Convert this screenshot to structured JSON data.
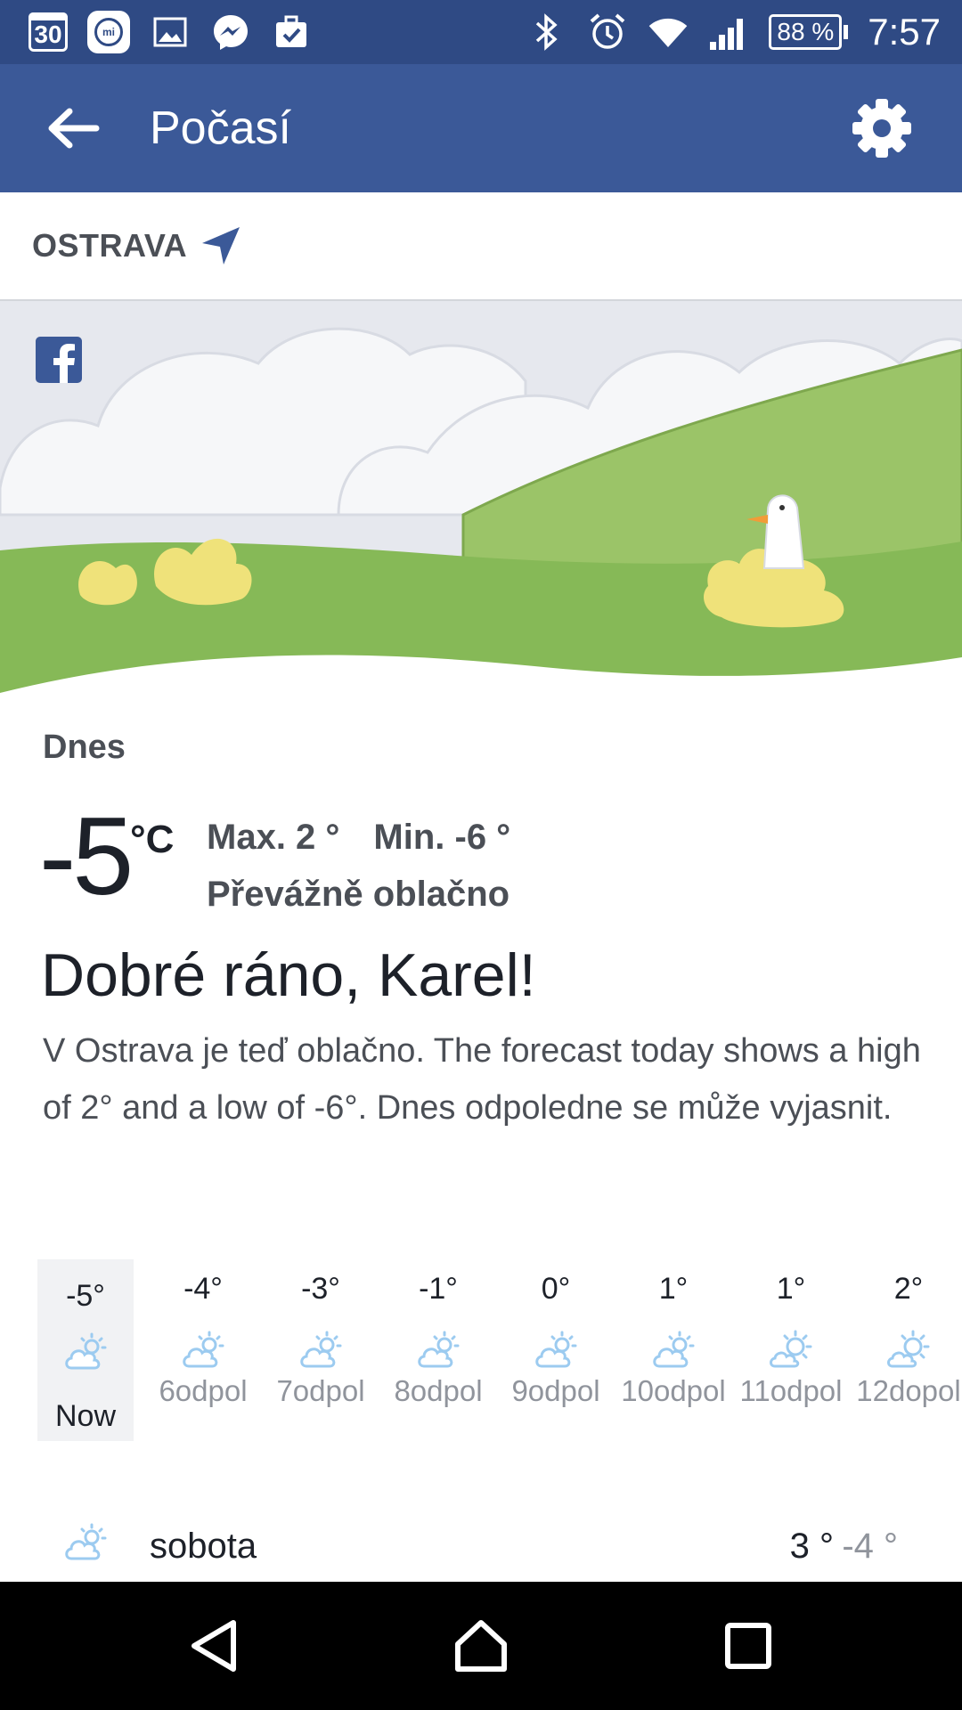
{
  "status_bar": {
    "calendar_day": "30",
    "mi_label": "mi",
    "battery": "88 %",
    "time": "7:57",
    "icons": [
      "calendar-icon",
      "mi-icon",
      "gallery-icon",
      "messenger-icon",
      "briefcase-check-icon",
      "bluetooth-icon",
      "alarm-icon",
      "wifi-icon",
      "signal-icon",
      "battery-icon"
    ]
  },
  "app_bar": {
    "title": "Počasí",
    "back_icon": "arrow-left-icon",
    "settings_icon": "gear-icon",
    "color": "#3b5998"
  },
  "location": {
    "name": "OSTRAVA",
    "icon": "location-arrow-icon"
  },
  "today": {
    "label": "Dnes",
    "temp": "-5",
    "unit": "°C",
    "max": "Max. 2 °",
    "min": "Min. -6 °",
    "condition": "Převážně oblačno",
    "greeting": "Dobré ráno, Karel!",
    "summary": "V Ostrava je teď oblačno. The forecast today shows a high of 2° and a low of -6°. Dnes odpoledne se může vyjasnit."
  },
  "hourly": [
    {
      "temp": "-5°",
      "label": "Now",
      "icon": "partly-cloudy-icon",
      "active": true
    },
    {
      "temp": "-4°",
      "label": "6odpol",
      "icon": "partly-cloudy-icon"
    },
    {
      "temp": "-3°",
      "label": "7odpol",
      "icon": "partly-cloudy-icon"
    },
    {
      "temp": "-1°",
      "label": "8odpol",
      "icon": "partly-cloudy-icon"
    },
    {
      "temp": "0°",
      "label": "9odpol",
      "icon": "partly-cloudy-icon"
    },
    {
      "temp": "1°",
      "label": "10odpol",
      "icon": "partly-cloudy-icon"
    },
    {
      "temp": "1°",
      "label": "11odpol",
      "icon": "mostly-sunny-icon"
    },
    {
      "temp": "2°",
      "label": "12dopol",
      "icon": "mostly-sunny-icon"
    }
  ],
  "daily": [
    {
      "day": "sobota",
      "max": "3 °",
      "min": "-4 °",
      "icon": "partly-cloudy-icon"
    }
  ],
  "nav_bar": {
    "icons": [
      "nav-back-icon",
      "nav-home-icon",
      "nav-recents-icon"
    ]
  },
  "colors": {
    "status_bar": "#2f4a84",
    "app_bar": "#3b5998",
    "weather_icon": "#9ccbf0",
    "grass": "#86b957"
  }
}
